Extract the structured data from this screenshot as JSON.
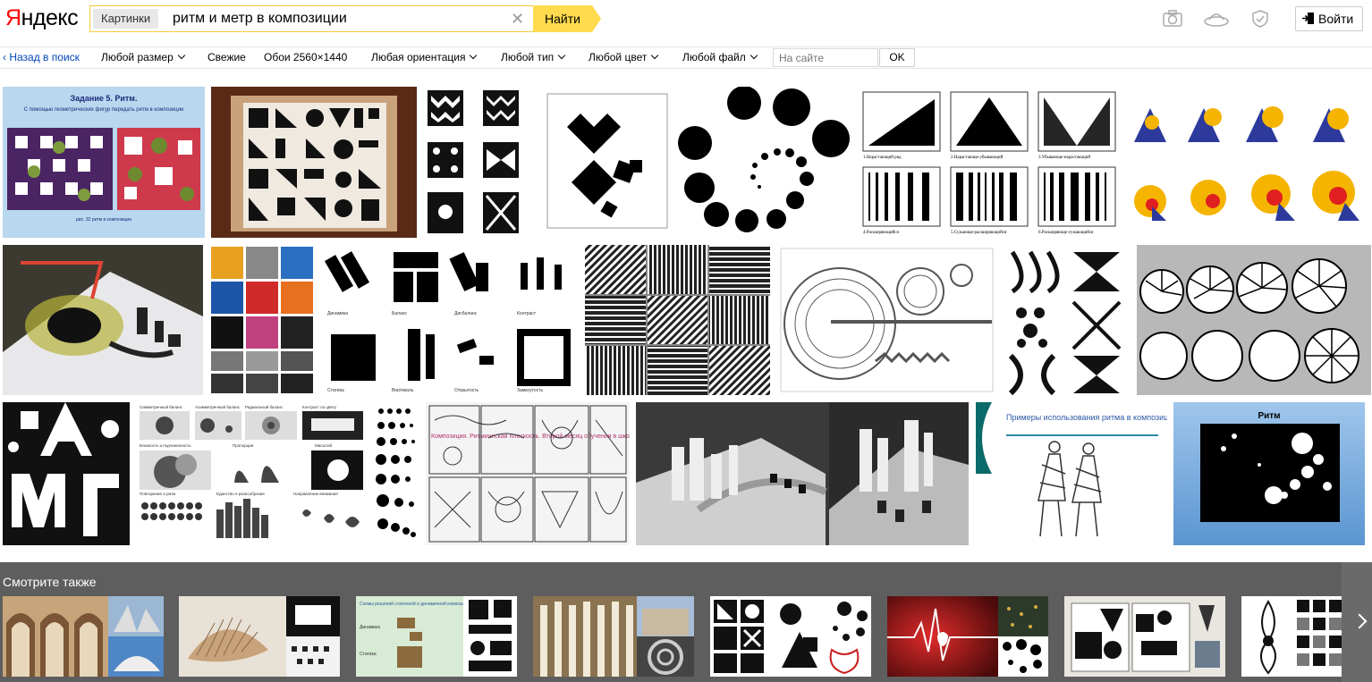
{
  "header": {
    "logo": "Яндекс",
    "service_tag": "Картинки",
    "query": "ритм и метр в композиции",
    "search_button": "Найти",
    "login_button": "Войти",
    "icons": [
      "camera-icon",
      "disk-icon",
      "shield-icon"
    ]
  },
  "filters": {
    "back": "Назад в поиск",
    "size": "Любой размер",
    "fresh": "Свежие",
    "wallpaper": "Обои 2560×1440",
    "orientation": "Любая ориентация",
    "type": "Любой тип",
    "color": "Любой цвет",
    "file": "Любой файл",
    "site_placeholder": "На сайте",
    "ok": "OK"
  },
  "results": {
    "row1": {
      "t1_title": "Задание 5. Ритм.",
      "t1_sub": "С помощью геометрических фигур передать ритм в композиции",
      "t1_caption": "рис. 32 ритм в композиции",
      "t5_labels": [
        "1.Нарастающий ряд",
        "2.Нарастающе-убывающий",
        "3.Убывающе-нарастающий",
        "4.Расширяющийся",
        "5.Сужающе-расширяющийся",
        "6.Расширяюще-сужающийся"
      ]
    },
    "row2": {
      "t4_labels": [
        "Динамика",
        "Баланс",
        "Дисбаланс",
        "Контраст",
        "Статика",
        "Вертикаль",
        "Открытость",
        "Замкнутость"
      ]
    },
    "row3": {
      "t2_labels": [
        "Симметричный баланс",
        "Асимметричный баланс",
        "Радиальный баланс",
        "Контраст по цвету",
        "Близкость и подчиненность",
        "Пропорции",
        "Масштаб",
        "Повторение и ритм",
        "Единство и разнообразие",
        "Направление внимания"
      ],
      "t4_title": "Композиция. Ритмическая плоскость. Второй месяц обучения в школе",
      "t6_title": "Примеры использования ритма в композиции костюма",
      "t7_title": "Ритм"
    }
  },
  "see_also": {
    "title": "Смотрите также",
    "item3_text": [
      "Схемы решений статичной и динамичной композиции",
      "Динамика",
      "Статика"
    ]
  },
  "colors": {
    "accent_yellow": "#ffdb4d",
    "logo_red": "#ff0000",
    "link_blue": "#0044bb",
    "see_also_bg": "#5e5e5e"
  }
}
